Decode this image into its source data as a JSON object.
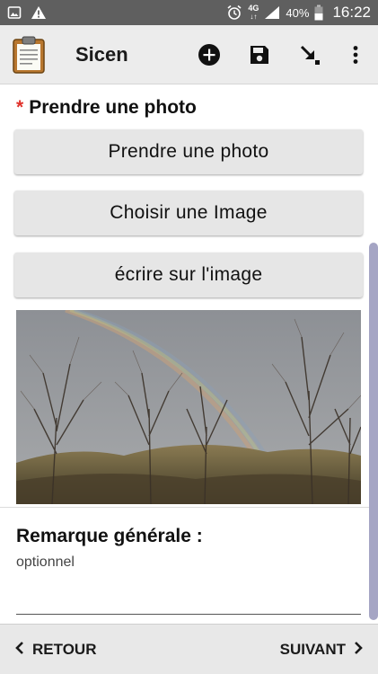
{
  "status_bar": {
    "network": "4G",
    "battery": "40%",
    "time": "16:22",
    "left_icons": [
      "image-notification-icon",
      "warning-icon"
    ],
    "right_icons": [
      "alarm-icon",
      "network-4g-icon",
      "signal-icon",
      "battery-icon"
    ]
  },
  "app_bar": {
    "title": "Sicen",
    "logo_icon": "clipboard-icon",
    "actions": [
      {
        "name": "add",
        "icon": "add-circle-icon"
      },
      {
        "name": "save",
        "icon": "save-icon"
      },
      {
        "name": "go-to",
        "icon": "arrow-down-right-icon"
      },
      {
        "name": "menu",
        "icon": "more-vert-icon"
      }
    ]
  },
  "form": {
    "question": {
      "required_marker": "*",
      "label": "Prendre une photo"
    },
    "buttons": {
      "take_photo": "Prendre une photo",
      "choose_image": "Choisir une Image",
      "draw_on_image": "écrire sur l'image"
    },
    "remark": {
      "label": "Remarque générale :",
      "hint": "optionnel",
      "value": ""
    }
  },
  "bottom_nav": {
    "back_label": "RETOUR",
    "next_label": "SUIVANT"
  },
  "colors": {
    "status_bar": "#5f5f5f",
    "app_bar": "#ececec",
    "required": "#e0312a",
    "button_bg": "#e6e6e6",
    "scrollbar": "#a5a5c4",
    "bottom_bar": "#e8e8e8"
  }
}
